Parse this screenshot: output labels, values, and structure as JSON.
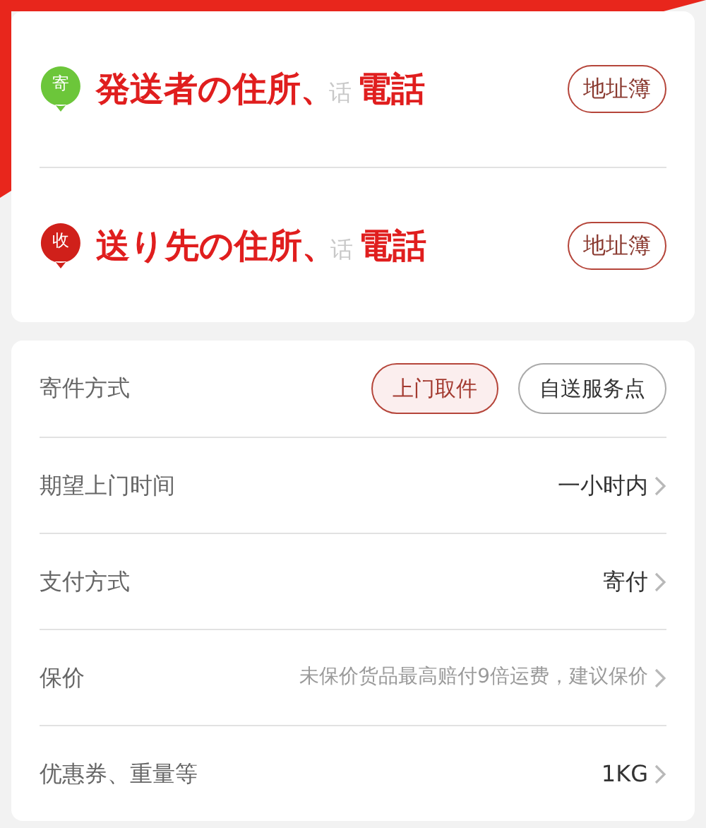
{
  "contacts": [
    {
      "badge": "寄",
      "color": "#6cc63a",
      "note": "発送者の住所、",
      "placeholder_tail": "话",
      "note_end": "電話",
      "button": "地址簿"
    },
    {
      "badge": "收",
      "color": "#d0201a",
      "note": "送り先の住所、",
      "placeholder_tail": "话",
      "note_end": "電話",
      "button": "地址簿"
    }
  ],
  "options": [
    {
      "kind": "choice",
      "label": "寄件方式",
      "choices": [
        {
          "label": "上门取件",
          "selected": true
        },
        {
          "label": "自送服务点",
          "selected": false
        }
      ]
    },
    {
      "kind": "link",
      "label": "期望上门时间",
      "value": "一小时内",
      "muted": false
    },
    {
      "kind": "link",
      "label": "支付方式",
      "value": "寄付",
      "muted": false
    },
    {
      "kind": "link",
      "label": "保价",
      "value": "未保价货品最高赔付9倍运费，建议保价",
      "muted": true
    },
    {
      "kind": "link",
      "label": "优惠券、重量等",
      "value": "1KG",
      "muted": false
    }
  ]
}
